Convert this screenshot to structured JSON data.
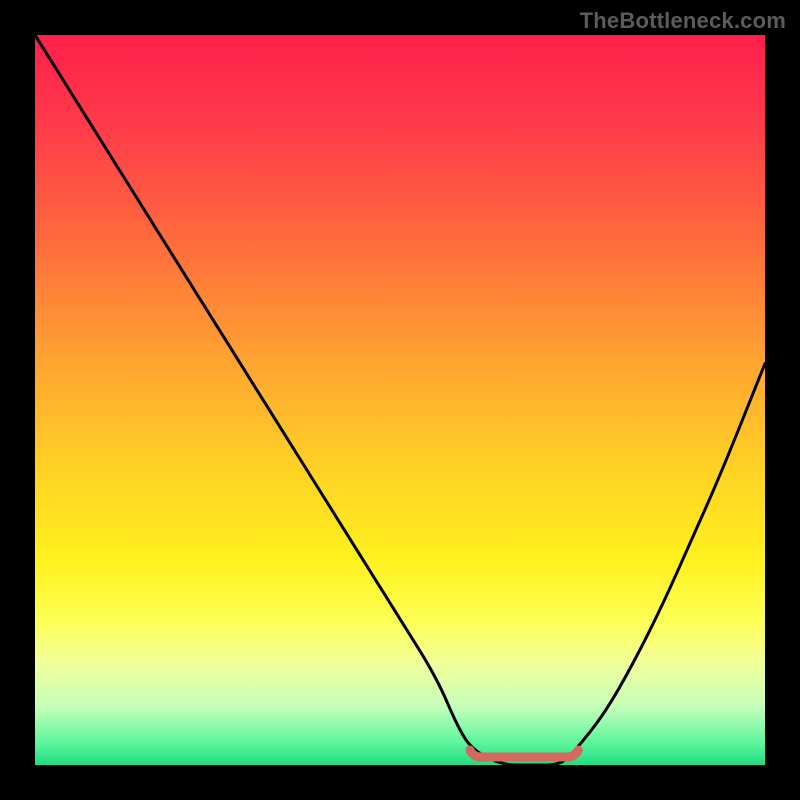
{
  "watermark": {
    "text": "TheBottleneck.com"
  },
  "colors": {
    "background": "#000000",
    "curve_stroke": "#000000",
    "trough_stroke": "#d46a5f",
    "gradient_stops": [
      {
        "offset": "0%",
        "color": "#ff1f4b"
      },
      {
        "offset": "12%",
        "color": "#ff3a4a"
      },
      {
        "offset": "28%",
        "color": "#ff6a3d"
      },
      {
        "offset": "45%",
        "color": "#ffa531"
      },
      {
        "offset": "60%",
        "color": "#ffd324"
      },
      {
        "offset": "72%",
        "color": "#fff11f"
      },
      {
        "offset": "80%",
        "color": "#fdff53"
      },
      {
        "offset": "86%",
        "color": "#f2ff9a"
      },
      {
        "offset": "92%",
        "color": "#c5ffba"
      },
      {
        "offset": "97%",
        "color": "#5cf59c"
      },
      {
        "offset": "100%",
        "color": "#1fdc82"
      }
    ]
  },
  "chart_data": {
    "type": "line",
    "title": "",
    "xlabel": "",
    "ylabel": "",
    "xlim": [
      0,
      100
    ],
    "ylim": [
      0,
      100
    ],
    "x": [
      0,
      5,
      10,
      15,
      20,
      25,
      30,
      35,
      40,
      45,
      50,
      55,
      58,
      60,
      64,
      68,
      72,
      74,
      78,
      82,
      86,
      90,
      94,
      100
    ],
    "values": [
      100,
      92,
      84,
      76,
      68,
      60,
      52,
      44,
      36,
      28,
      20,
      12,
      5,
      2,
      0,
      0,
      0,
      2,
      7,
      14,
      22,
      31,
      40,
      55
    ],
    "trough": {
      "x_start": 60,
      "x_end": 74,
      "y": 0
    },
    "annotations": []
  }
}
